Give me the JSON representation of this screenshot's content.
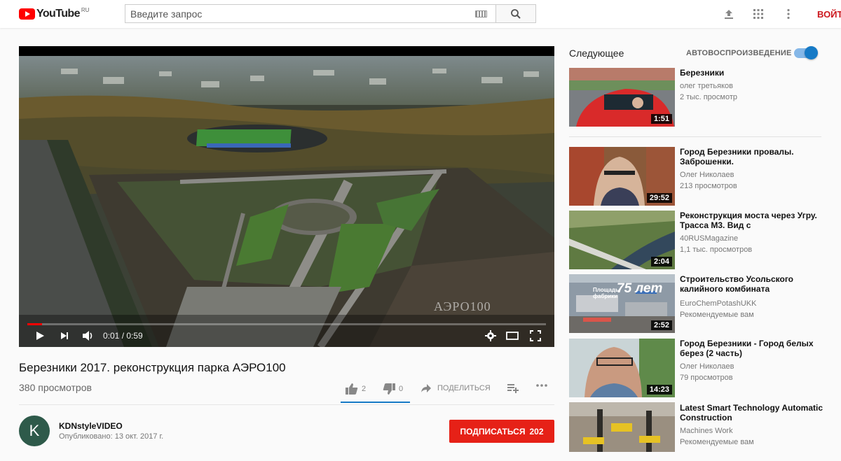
{
  "header": {
    "logo_text": "YouTube",
    "logo_region": "RU",
    "search_placeholder": "Введите запрос",
    "signin_label": "ВОЙТИ"
  },
  "player": {
    "time_display": "0:01 / 0:59",
    "progress_fraction": 0.028,
    "watermark": "АЭРО100"
  },
  "video": {
    "title": "Березники 2017. реконструкция парка АЭРО100",
    "views": "380 просмотров",
    "likes": "2",
    "dislikes": "0",
    "share_label": "ПОДЕЛИТЬСЯ"
  },
  "channel": {
    "avatar_letter": "K",
    "name": "KDNstyleVIDEO",
    "published": "Опубликовано: 13 окт. 2017 г.",
    "subscribe_label": "ПОДПИСАТЬСЯ",
    "subscribers": "202"
  },
  "sidebar": {
    "next_label": "Следующее",
    "autoplay_label": "АВТОВОСПРОИЗВЕДЕНИЕ",
    "autoplay_on": true,
    "items": [
      {
        "title": "Березники",
        "author": "олег третьяков",
        "meta": "2 тыс. просмотр",
        "duration": "1:51"
      },
      {
        "title": "Город Березники провалы. Заброшенки.",
        "author": "Олег Николаев",
        "meta": "213 просмотров",
        "duration": "29:52"
      },
      {
        "title": "Реконструкция моста через Угру. Трасса М3. Вид с",
        "author": "40RUSMagazine",
        "meta": "1,1 тыс. просмотров",
        "duration": "2:04"
      },
      {
        "title": "Строительство Усольского калийного комбината",
        "author": "EuroChemPotashUKK",
        "meta": "Рекомендуемые вам",
        "duration": "2:52",
        "overlay_text": "75 лет",
        "overlay_small": "Площадь фабрики"
      },
      {
        "title": "Город Березники - Город белых берез (2 часть)",
        "author": "Олег Николаев",
        "meta": "79 просмотров",
        "duration": "14:23"
      },
      {
        "title": "Latest Smart Technology Automatic Construction",
        "author": "Machines Work",
        "meta": "Рекомендуемые вам",
        "duration": ""
      }
    ]
  }
}
